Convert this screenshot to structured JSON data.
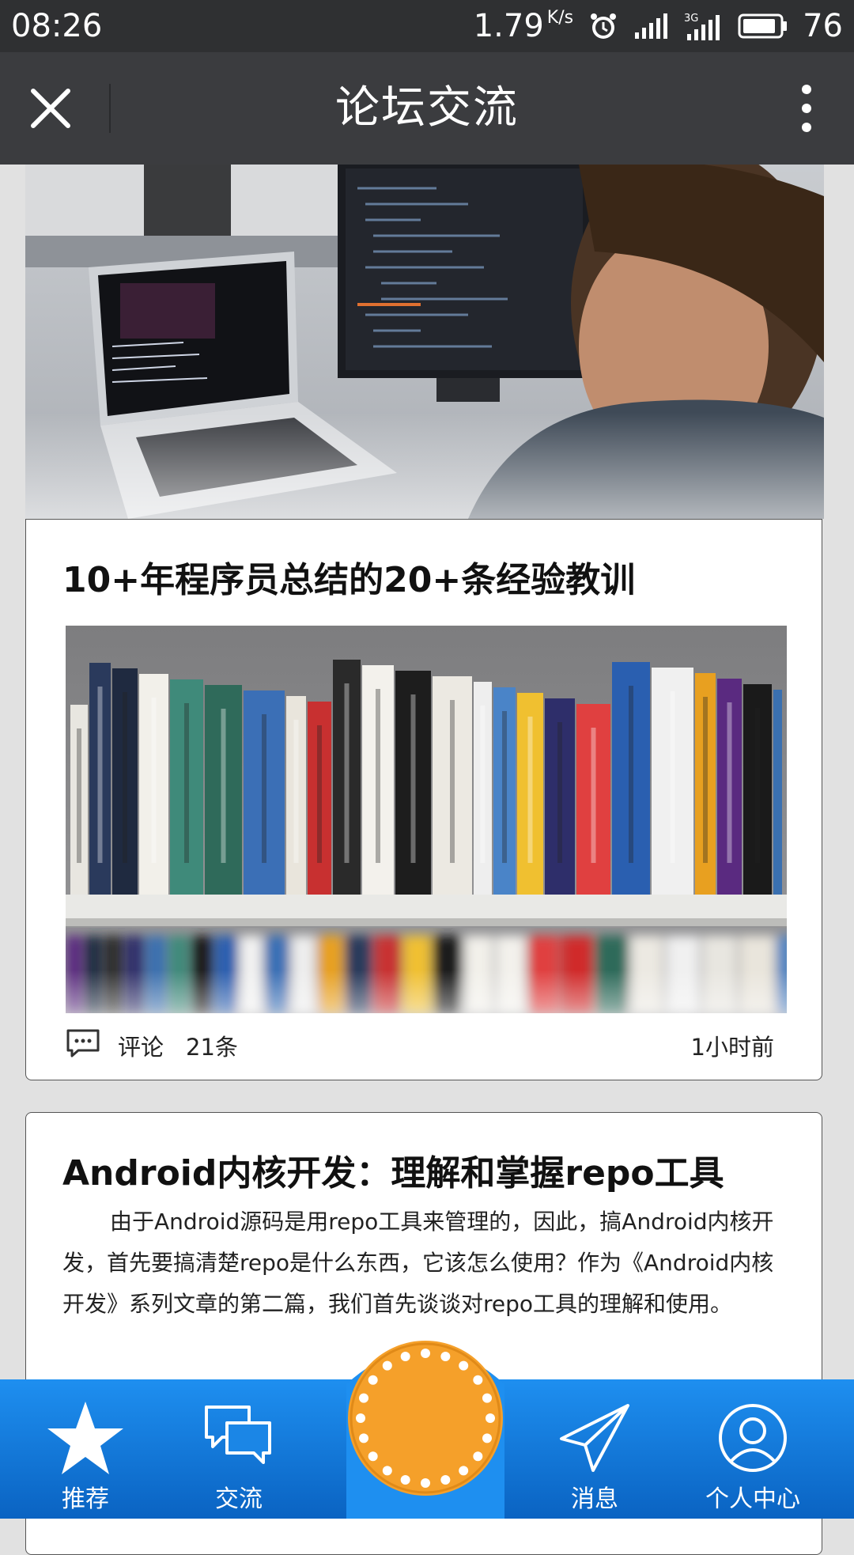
{
  "status_bar": {
    "time": "08:26",
    "network_speed": "1.79",
    "network_speed_unit": "K/s",
    "network_type": "3G",
    "battery_level": "76",
    "icons": [
      "alarm-icon",
      "signal-icon",
      "signal-3g-icon",
      "battery-icon"
    ]
  },
  "header": {
    "title": "论坛交流",
    "close_icon": "close-icon",
    "more_icon": "more-vertical-icon"
  },
  "posts": [
    {
      "title": "10+年程序员总结的20+条经验教训",
      "comment_label": "评论",
      "comment_count": "21条",
      "time": "1小时前",
      "comment_icon": "comment-icon"
    },
    {
      "title": "Android内核开发：理解和掌握repo工具",
      "excerpt": "由于Android源码是用repo工具来管理的，因此，搞Android内核开发，首先要搞清楚repo是什么东西，它该怎么使用？作为《Android内核开发》系列文章的第二篇，我们首先谈谈对repo工具的理解和使用。"
    }
  ],
  "tabbar": {
    "items": [
      {
        "label": "推荐",
        "icon": "star-icon"
      },
      {
        "label": "交流",
        "icon": "chat-bubbles-icon"
      },
      {
        "label": "消息",
        "icon": "paper-plane-icon"
      },
      {
        "label": "个人中心",
        "icon": "user-icon"
      }
    ],
    "center_button_icon": "center-action-icon"
  },
  "colors": {
    "status_bar": "#2f3032",
    "header": "#3b3c3f",
    "tabbar": "#1e8ff0",
    "center_button": "#f5a02a",
    "page_background": "#e1e1e1"
  }
}
